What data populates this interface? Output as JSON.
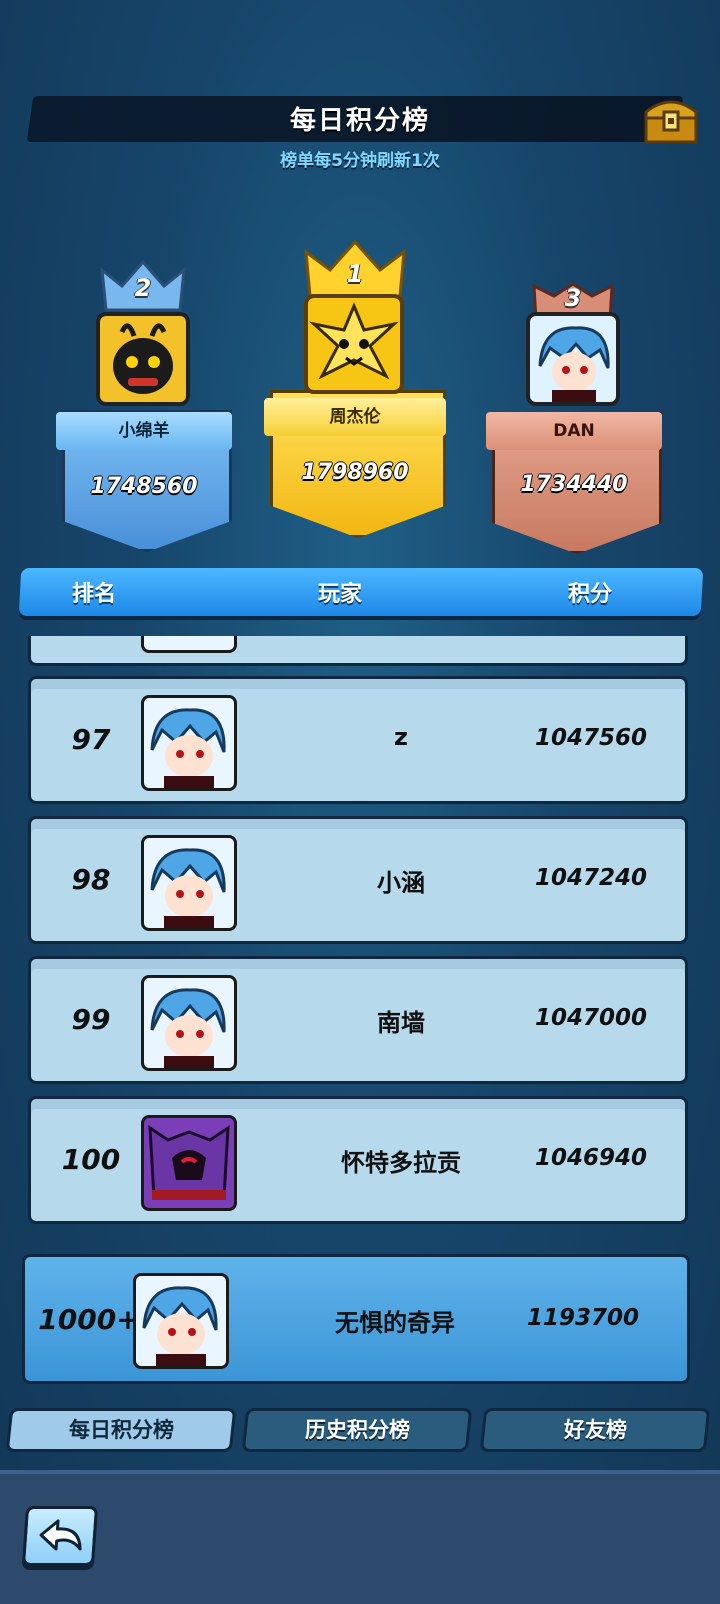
{
  "header": {
    "title": "每日积分榜",
    "subtitle": "榜单每5分钟刷新1次"
  },
  "podium": [
    {
      "rank": "2",
      "name": "小绵羊",
      "score": "1748560"
    },
    {
      "rank": "1",
      "name": "周杰伦",
      "score": "1798960"
    },
    {
      "rank": "3",
      "name": "DAN",
      "score": "1734440"
    }
  ],
  "columns": {
    "rank": "排名",
    "player": "玩家",
    "score": "积分"
  },
  "rows": [
    {
      "rank": "97",
      "name": "z",
      "score": "1047560"
    },
    {
      "rank": "98",
      "name": "小涵",
      "score": "1047240"
    },
    {
      "rank": "99",
      "name": "南墙",
      "score": "1047000"
    },
    {
      "rank": "100",
      "name": "怀特多拉贡",
      "score": "1046940"
    }
  ],
  "my_row": {
    "rank": "1000+",
    "name": "无惧的奇异",
    "score": "1193700"
  },
  "tabs": [
    "每日积分榜",
    "历史积分榜",
    "好友榜"
  ],
  "colors": {
    "gold": "#f5c21a",
    "silver": "#6fb4ee",
    "bronze": "#d98d76",
    "accent": "#2c96ee"
  }
}
